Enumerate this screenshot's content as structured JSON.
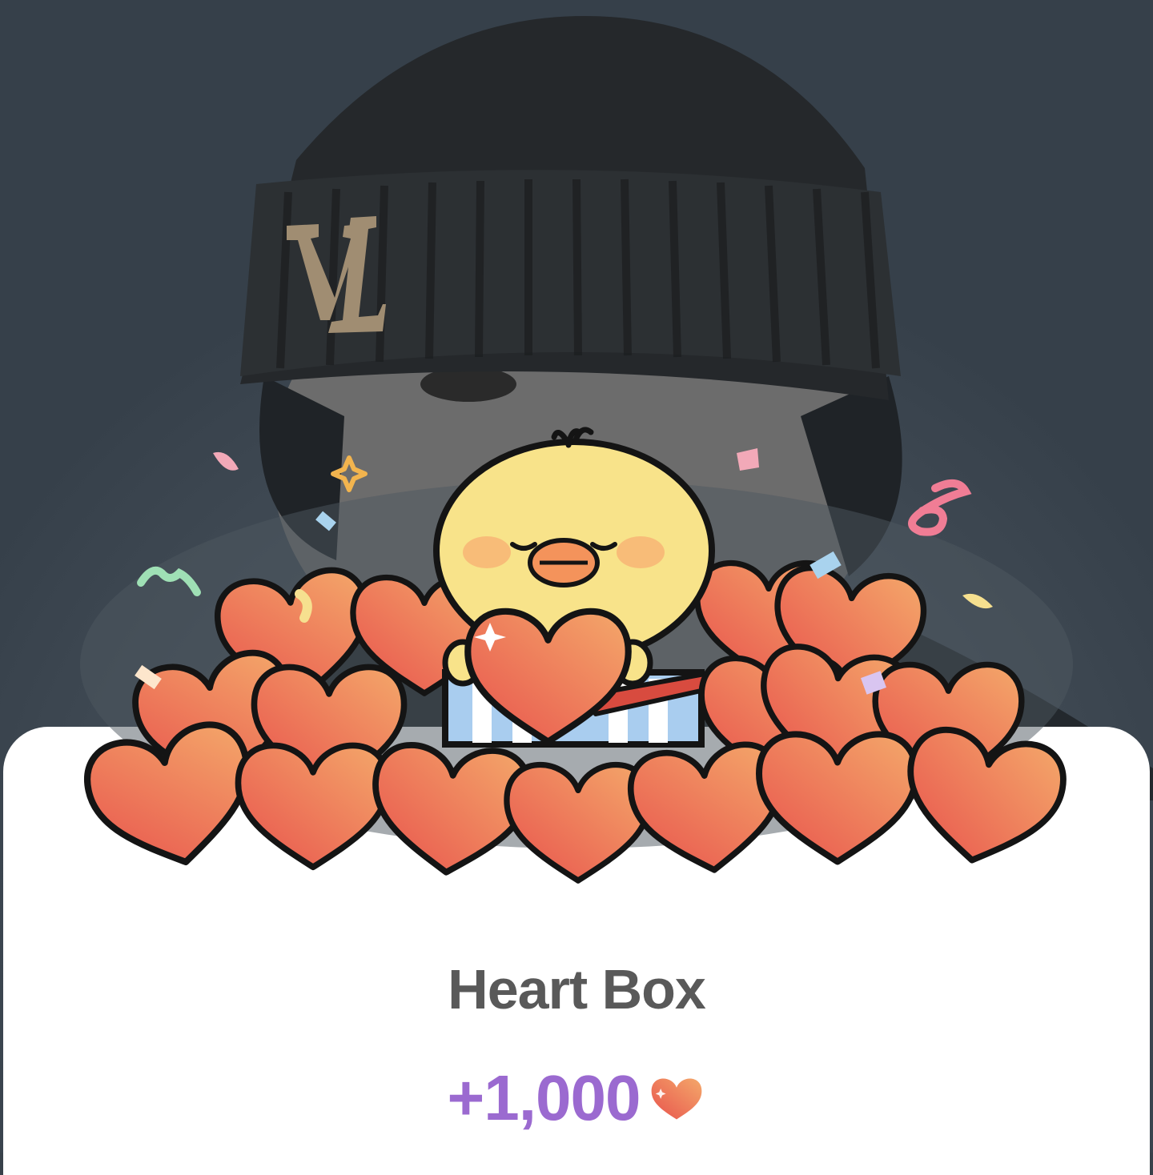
{
  "reward": {
    "title": "Heart Box",
    "amount": "+1,000",
    "currency_icon": "heart-icon"
  },
  "colors": {
    "backdrop": "#38414a",
    "sheet": "#ffffff",
    "title_text": "#595959",
    "amount_text": "#9b6ad0",
    "heart_top": "#f3a068",
    "heart_bottom": "#e8534d",
    "chick_body": "#f8e38a"
  },
  "icons": [
    "beanie-photo",
    "chick-mascot-icon",
    "heart-icon",
    "gift-box-icon",
    "confetti-icon",
    "sparkle-icon"
  ]
}
